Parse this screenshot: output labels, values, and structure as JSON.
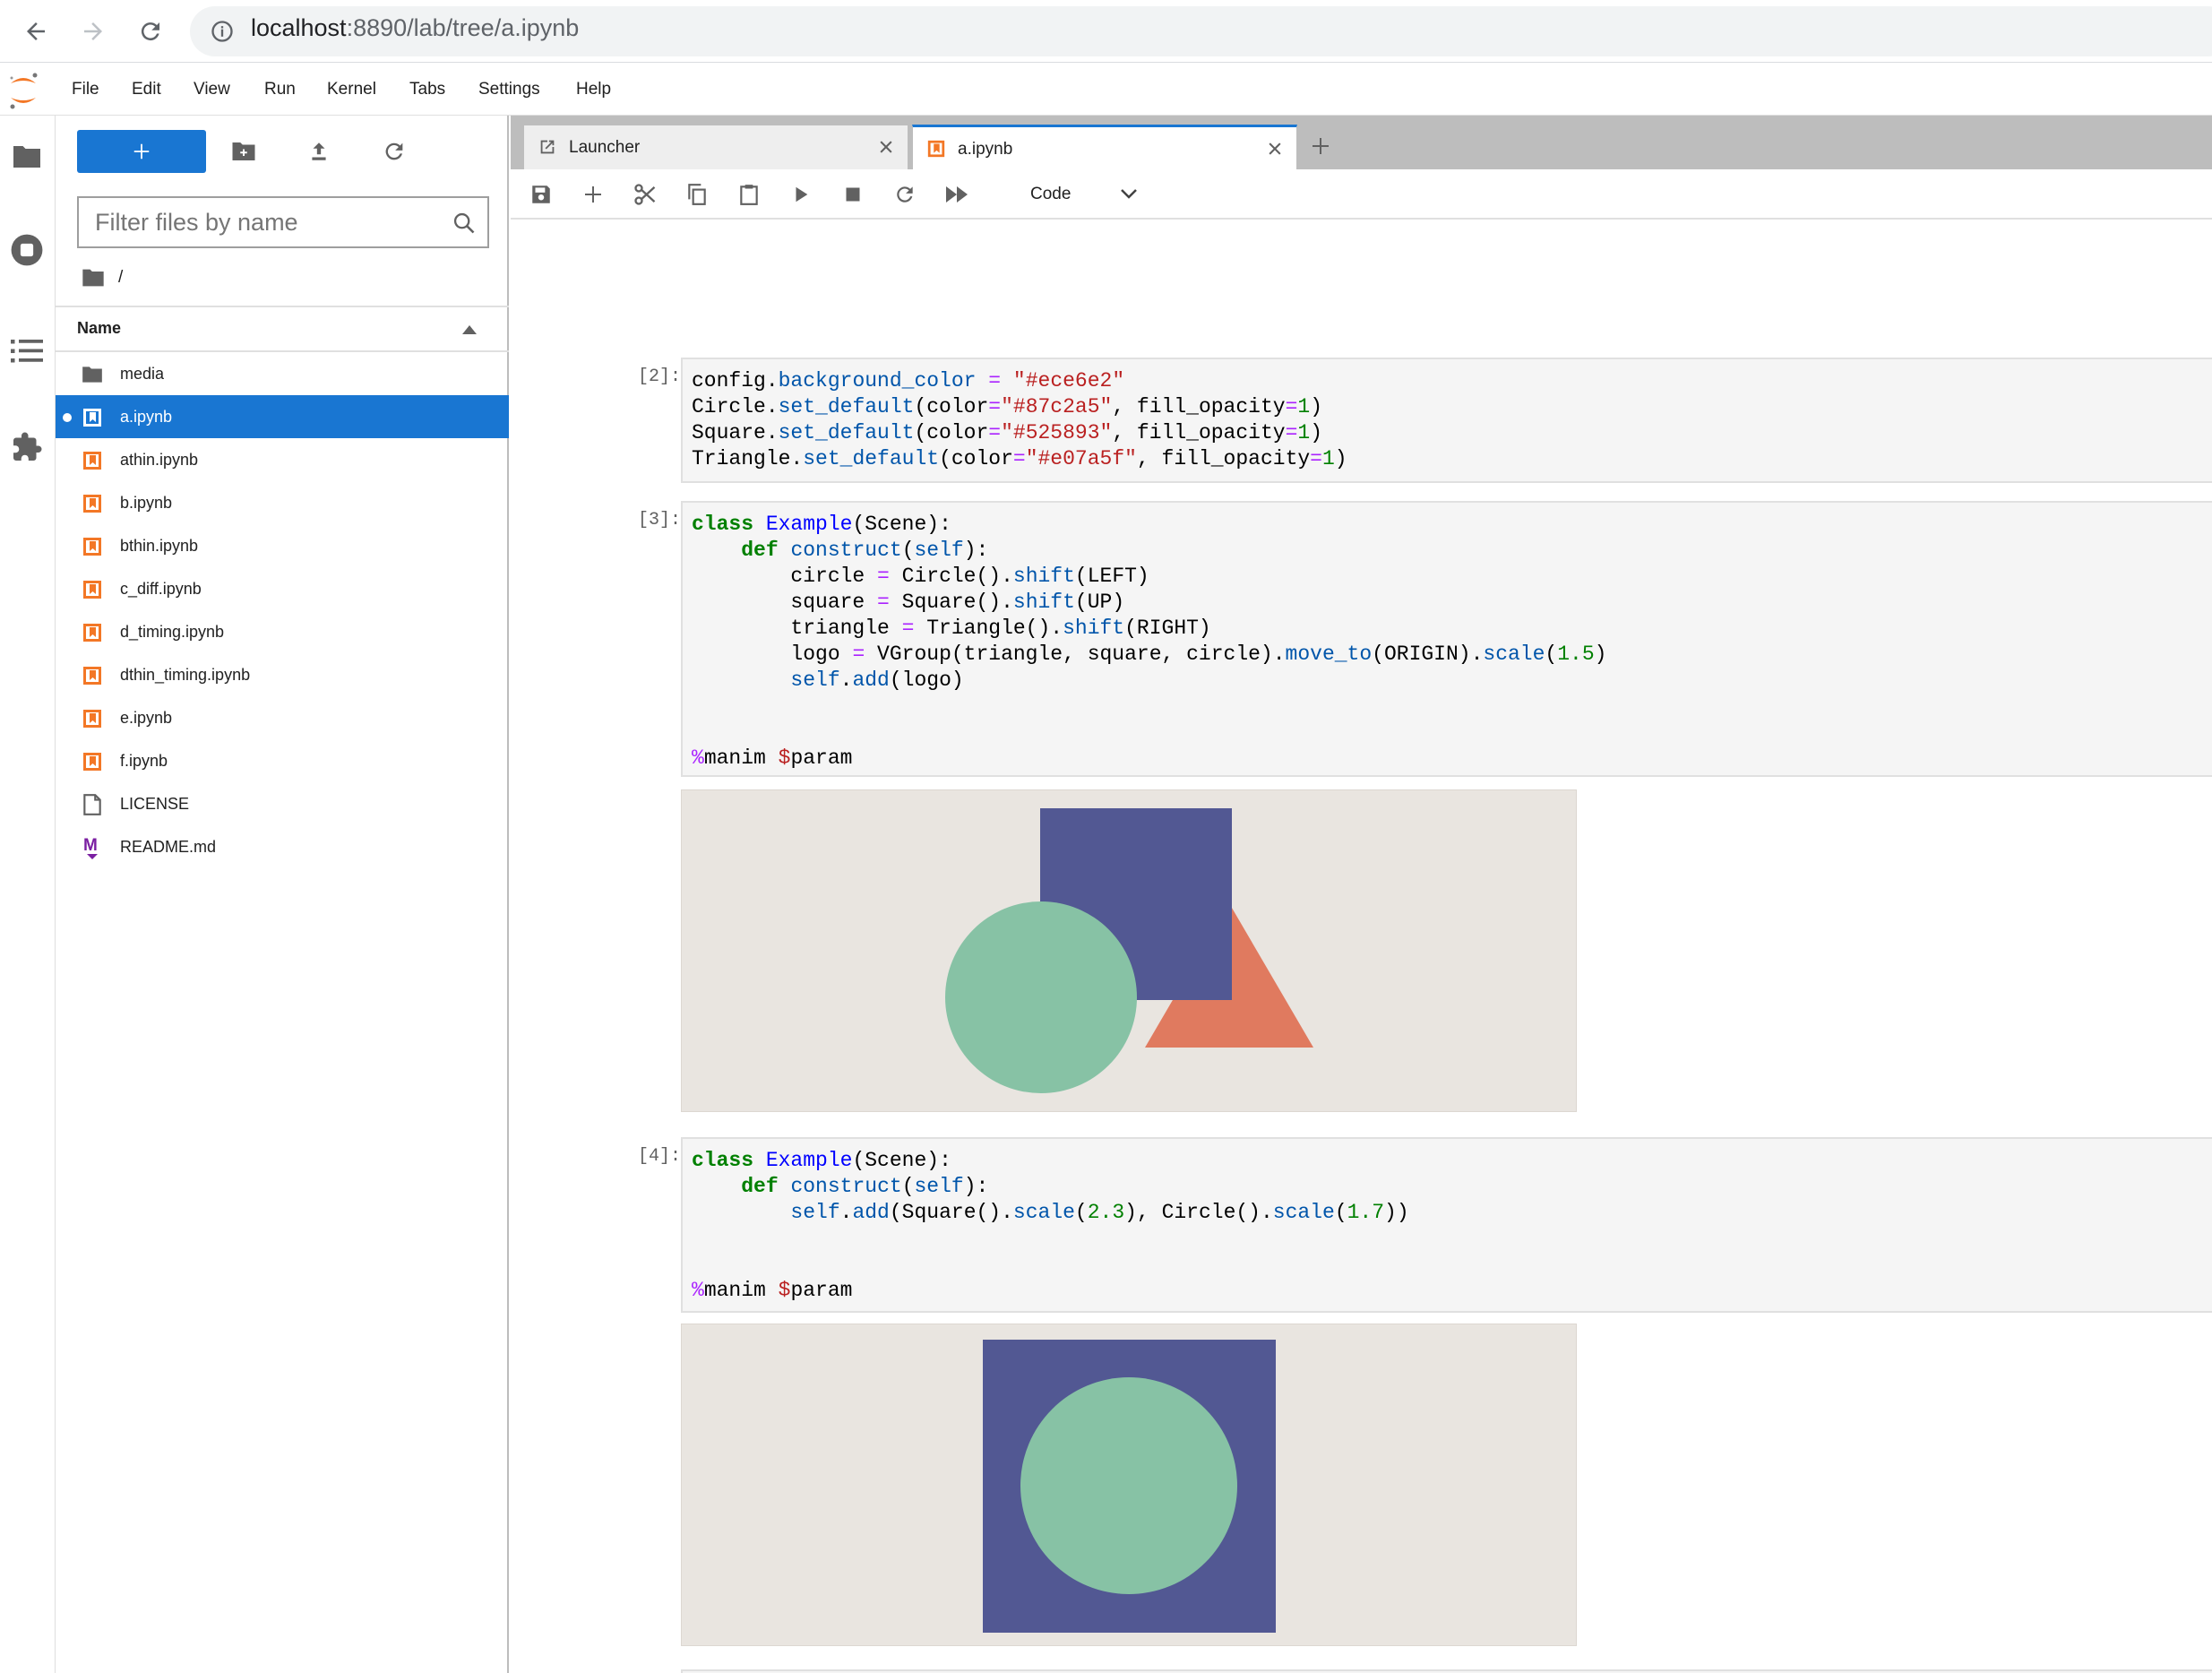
{
  "browser": {
    "url_host": "localhost",
    "url_rest": ":8890/lab/tree/a.ipynb"
  },
  "menu": {
    "items": [
      "File",
      "Edit",
      "View",
      "Run",
      "Kernel",
      "Tabs",
      "Settings",
      "Help"
    ]
  },
  "file_browser": {
    "filter_placeholder": "Filter files by name",
    "breadcrumb": "/",
    "column_name": "Name",
    "files": [
      {
        "name": "media",
        "type": "folder"
      },
      {
        "name": "a.ipynb",
        "type": "notebook",
        "selected": true,
        "running": true
      },
      {
        "name": "athin.ipynb",
        "type": "notebook"
      },
      {
        "name": "b.ipynb",
        "type": "notebook"
      },
      {
        "name": "bthin.ipynb",
        "type": "notebook"
      },
      {
        "name": "c_diff.ipynb",
        "type": "notebook"
      },
      {
        "name": "d_timing.ipynb",
        "type": "notebook"
      },
      {
        "name": "dthin_timing.ipynb",
        "type": "notebook"
      },
      {
        "name": "e.ipynb",
        "type": "notebook"
      },
      {
        "name": "f.ipynb",
        "type": "notebook"
      },
      {
        "name": "LICENSE",
        "type": "file"
      },
      {
        "name": "README.md",
        "type": "markdown"
      }
    ]
  },
  "tabs": [
    {
      "label": "Launcher",
      "active": false
    },
    {
      "label": "a.ipynb",
      "active": true
    }
  ],
  "toolbar": {
    "cell_type": "Code"
  },
  "cells": [
    {
      "prompt": "[2]:"
    },
    {
      "prompt": "[3]:"
    },
    {
      "prompt": "[4]:"
    },
    {
      "prompt": "[ ]:"
    }
  ],
  "colors": {
    "accent": "#1976d2",
    "background": "#ece6e2",
    "circle": "#87c2a5",
    "square": "#525893",
    "triangle": "#e07a5f"
  }
}
